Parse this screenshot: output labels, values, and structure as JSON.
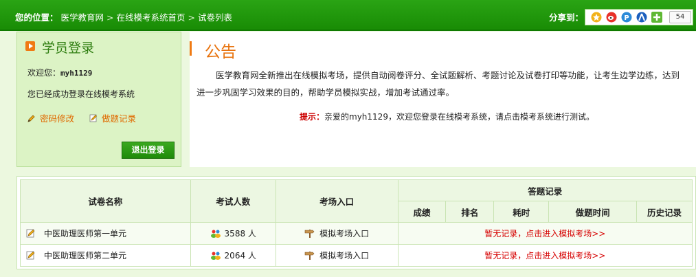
{
  "breadcrumb": {
    "label": "您的位置：",
    "items": [
      "医学教育网",
      "在线模考系统首页",
      "试卷列表"
    ],
    "separator": ">"
  },
  "share": {
    "label": "分享到：",
    "count": "54",
    "icons": [
      "qzone-icon",
      "weibo-icon",
      "pengyou-icon",
      "renren-icon",
      "plus-icon"
    ]
  },
  "login": {
    "title": "学员登录",
    "welcome_prefix": "欢迎您：",
    "username": "myh1129",
    "status": "您已经成功登录在线模考系统",
    "change_password": "密码修改",
    "records": "做题记录",
    "logout": "退出登录"
  },
  "notice": {
    "title": "公告",
    "body": "医学教育网全新推出在线模拟考场，提供自动阅卷评分、全试题解析、考题讨论及试卷打印等功能，让考生边学边练，达到进一步巩固学习效果的目的，帮助学员模拟实战，增加考试通过率。",
    "tip_label": "提示：",
    "tip_text": "亲爱的myh1129，欢迎您登录在线模考系统，请点击模考系统进行测试。"
  },
  "table": {
    "headers": {
      "name": "试卷名称",
      "count": "考试人数",
      "entry": "考场入口",
      "records": "答题记录",
      "score": "成绩",
      "rank": "排名",
      "time_used": "耗时",
      "answer_time": "做题时间",
      "history": "历史记录"
    },
    "rows": [
      {
        "name": "中医助理医师第一单元",
        "count": "3588 人",
        "entry": "模拟考场入口",
        "record": "暂无记录，点击进入模拟考场>>"
      },
      {
        "name": "中医助理医师第二单元",
        "count": "2064 人",
        "entry": "模拟考场入口",
        "record": "暂无记录，点击进入模拟考场>>"
      }
    ]
  },
  "colors": {
    "topbar": "#198c05",
    "accent_orange": "#e8730e",
    "link_red": "#d60000",
    "panel_green": "#dcf3c5"
  }
}
